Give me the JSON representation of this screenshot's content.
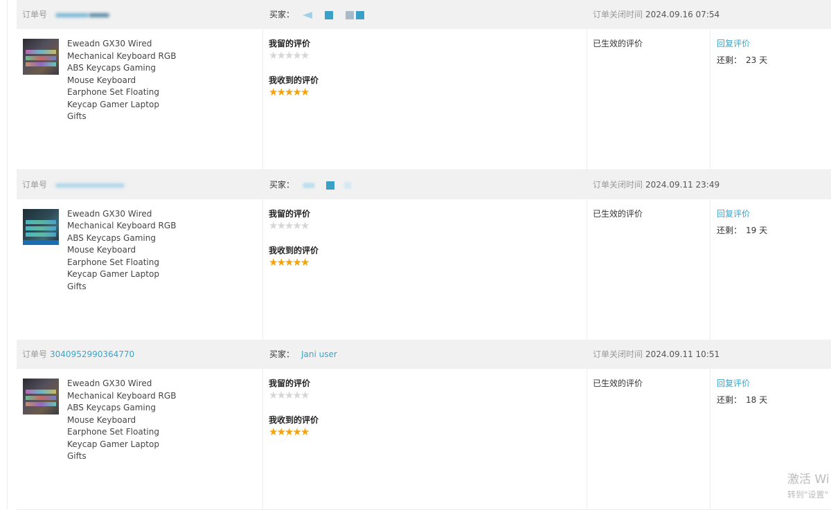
{
  "labels": {
    "order_no": "订单号",
    "buyer": "买家：",
    "close_time": "订单关闭时间",
    "my_review": "我留的评价",
    "received_review": "我收到的评价",
    "status": "已生效的评价",
    "reply": "回复评价",
    "remaining": "还剩：",
    "days_unit": "天"
  },
  "colors": {
    "link": "#3ba5c9",
    "star_on": "#f5a20c",
    "star_off": "#d6d6d6",
    "header_bg": "#f1f1f1"
  },
  "orders": [
    {
      "order_no": "",
      "buyer": "",
      "close_time": "2024.09.16 07:54",
      "product_title": "Eweadn GX30 Wired Mechanical Keyboard RGB ABS Keycaps Gaming Mouse Keyboard Earphone Set Floating Keycap Gamer Laptop Gifts",
      "my_rating": 0,
      "received_rating": 5,
      "days_left": "23"
    },
    {
      "order_no": "",
      "buyer": "",
      "close_time": "2024.09.11 23:49",
      "product_title": "Eweadn GX30 Wired Mechanical Keyboard RGB ABS Keycaps Gaming Mouse Keyboard Earphone Set Floating Keycap Gamer Laptop Gifts",
      "my_rating": 0,
      "received_rating": 5,
      "days_left": "19"
    },
    {
      "order_no": "3040952990364770",
      "buyer": "Jani user",
      "close_time": "2024.09.11 10:51",
      "product_title": "Eweadn GX30 Wired Mechanical Keyboard RGB ABS Keycaps Gaming Mouse Keyboard Earphone Set Floating Keycap Gamer Laptop Gifts",
      "my_rating": 0,
      "received_rating": 5,
      "days_left": "18"
    }
  ],
  "watermark": {
    "line1": "激活 Wi",
    "line2": "转到\"设置\""
  }
}
